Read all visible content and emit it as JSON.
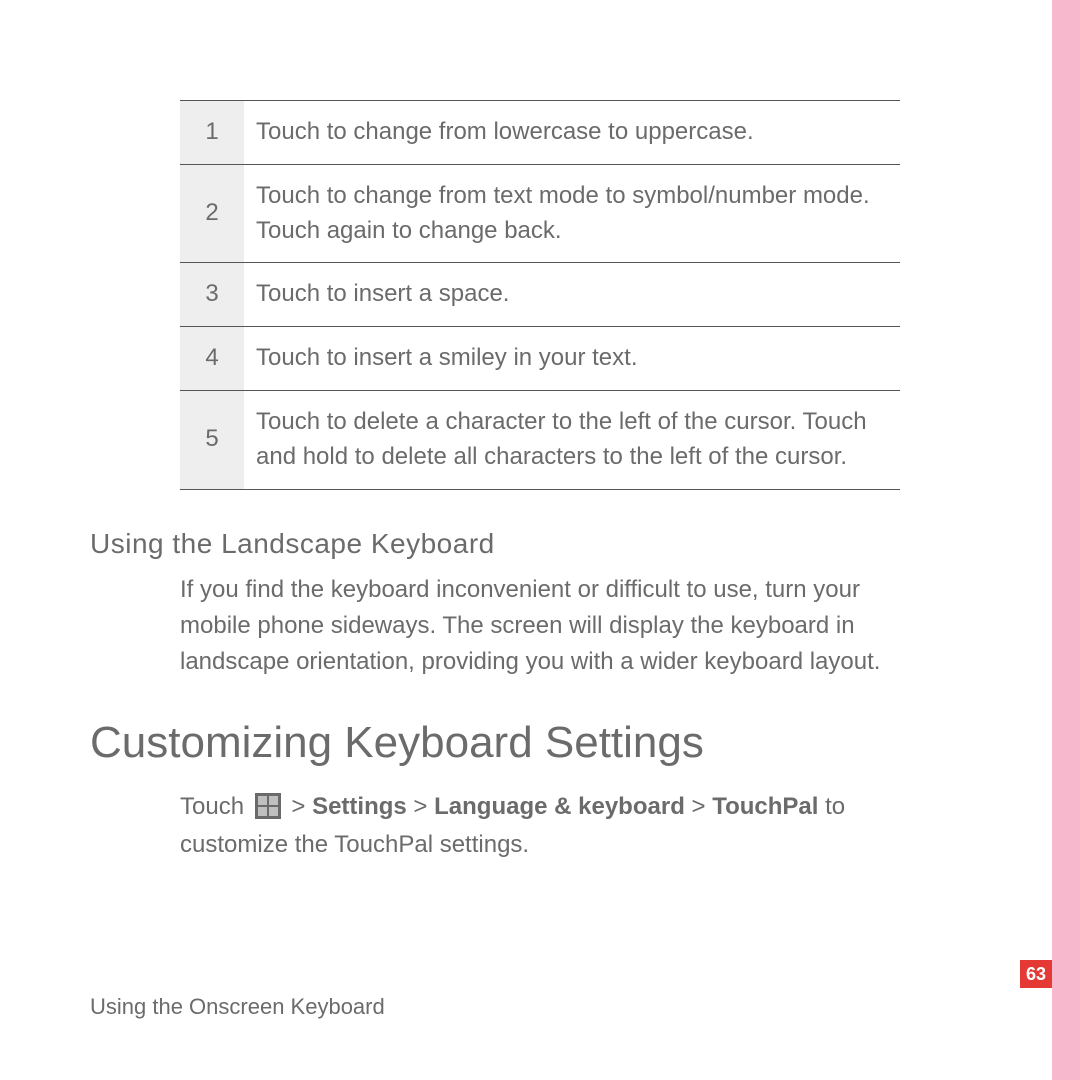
{
  "table": {
    "rows": [
      {
        "n": "1",
        "text": "Touch to change from lowercase to uppercase."
      },
      {
        "n": "2",
        "text": "Touch to change from text mode to symbol/number mode. Touch again to change back."
      },
      {
        "n": "3",
        "text": "Touch to insert a space."
      },
      {
        "n": "4",
        "text": "Touch to insert a smiley in your text."
      },
      {
        "n": "5",
        "text": "Touch to delete a character to the left of the cursor. Touch and hold to delete all characters to the left of the cursor."
      }
    ]
  },
  "sub1": {
    "title": "Using  the Landscape Keyboard",
    "body": "If you find the keyboard inconvenient or difficult to use, turn your mobile phone sideways. The screen will display the keyboard in landscape orientation, providing you with a wider keyboard layout."
  },
  "section2": {
    "title": "Customizing Keyboard Settings",
    "touch_prefix": "Touch ",
    "path_sep": " > ",
    "path": [
      "Settings",
      "Language & keyboard",
      "TouchPal"
    ],
    "touch_suffix": " to customize the TouchPal settings."
  },
  "footer": "Using the Onscreen Keyboard",
  "page_number": "63"
}
